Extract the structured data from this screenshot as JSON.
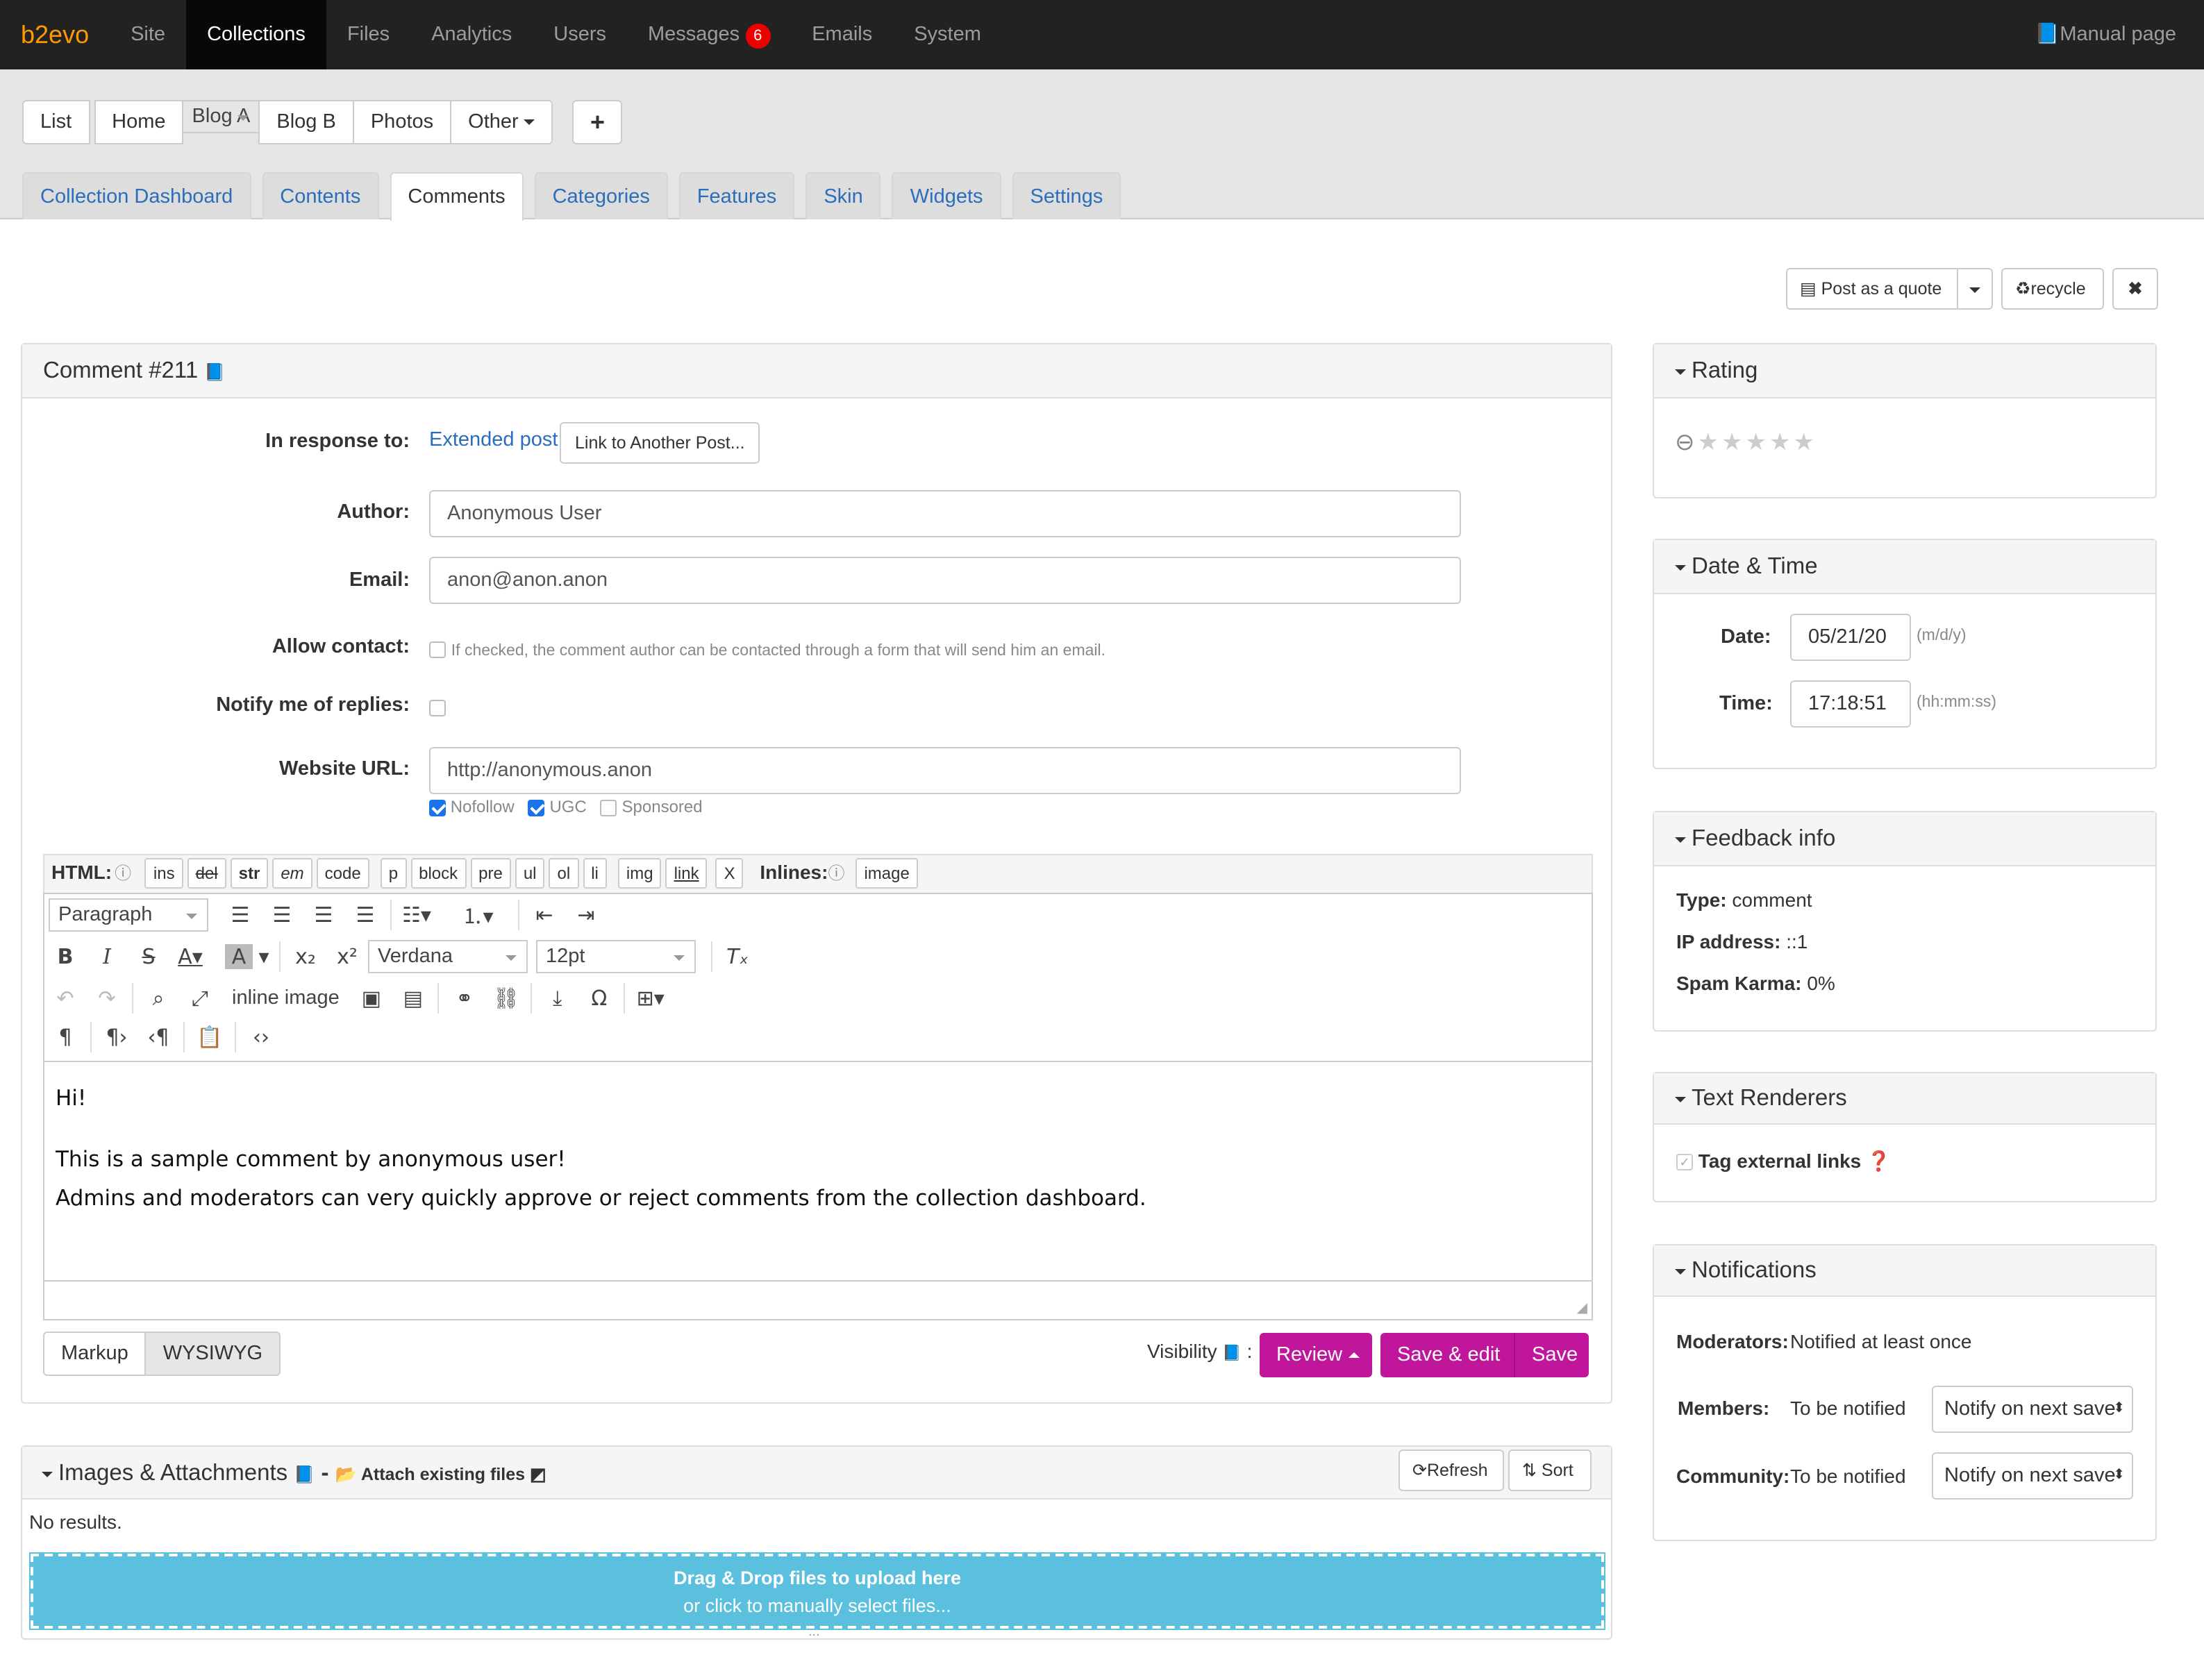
{
  "topnav": {
    "brand": "b2evo",
    "items": [
      "Site",
      "Collections",
      "Files",
      "Analytics",
      "Users",
      "Messages",
      "Emails",
      "System"
    ],
    "messages_badge": "6",
    "manual": "Manual page"
  },
  "collections": {
    "items": [
      "List",
      "Home",
      "Blog A",
      "Blog B",
      "Photos",
      "Other"
    ],
    "add": "+"
  },
  "tabs": [
    "Collection Dashboard",
    "Contents",
    "Comments",
    "Categories",
    "Features",
    "Skin",
    "Widgets",
    "Settings"
  ],
  "actions": {
    "post_quote": "Post as a quote",
    "recycle": "recycle",
    "close": "✖"
  },
  "comment": {
    "title": "Comment #211",
    "in_response_label": "In response to:",
    "in_response_link": "Extended post",
    "link_another": "Link to Another Post...",
    "author_label": "Author:",
    "author": "Anonymous User",
    "email_label": "Email:",
    "email": "anon@anon.anon",
    "allow_contact_label": "Allow contact:",
    "allow_contact_note": "If checked, the comment author can be contacted through a form that will send him an email.",
    "notify_label": "Notify me of replies:",
    "url_label": "Website URL:",
    "url": "http://anonymous.anon",
    "nofollow": "Nofollow",
    "ugc": "UGC",
    "sponsored": "Sponsored"
  },
  "quicktags": {
    "html_label": "HTML:",
    "tags": [
      "ins",
      "del",
      "str",
      "em",
      "code",
      "p",
      "block",
      "pre",
      "ul",
      "ol",
      "li",
      "img",
      "link",
      "X"
    ],
    "inlines_label": "Inlines:",
    "inline_tags": [
      "image"
    ]
  },
  "editor": {
    "format": "Paragraph",
    "font": "Verdana",
    "size": "12pt",
    "inline_image": "inline image",
    "content": [
      "Hi!",
      "This is a sample comment by anonymous user!",
      "Admins and moderators can very quickly approve or reject comments from the collection dashboard."
    ]
  },
  "editor_mode": {
    "markup": "Markup",
    "wysiwyg": "WYSIWYG"
  },
  "save": {
    "visibility": "Visibility",
    "colon": ":",
    "review": "Review",
    "save_edit": "Save & edit",
    "save": "Save"
  },
  "attachments": {
    "title": "Images & Attachments",
    "dash": "-",
    "attach": "Attach existing files",
    "refresh": "Refresh",
    "sort": "Sort",
    "no_results": "No results.",
    "drop_title": "Drag & Drop files to upload here",
    "drop_sub": "or click to manually select files...",
    "grip": "..."
  },
  "rating": {
    "title": "Rating",
    "stars": 0
  },
  "datetime": {
    "title": "Date & Time",
    "date_label": "Date:",
    "date": "05/21/20",
    "date_fmt": "(m/d/y)",
    "time_label": "Time:",
    "time": "17:18:51",
    "time_fmt": "(hh:mm:ss)"
  },
  "feedback": {
    "title": "Feedback info",
    "type_label": "Type:",
    "type": "comment",
    "ip_label": "IP address:",
    "ip": "::1",
    "karma_label": "Spam Karma:",
    "karma": "0%"
  },
  "renderers": {
    "title": "Text Renderers",
    "tag_external": "Tag external links"
  },
  "notifications": {
    "title": "Notifications",
    "moderators_label": "Moderators:",
    "moderators": "Notified at least once",
    "members_label": "Members:",
    "members": "To be notified",
    "members_select": "Notify on next save",
    "community_label": "Community:",
    "community": "To be notified",
    "community_select": "Notify on next save"
  },
  "colors": {
    "accent": "#c0169b",
    "link": "#2a6ebb",
    "drop": "#5bc0de",
    "brand": "#ff9900"
  }
}
